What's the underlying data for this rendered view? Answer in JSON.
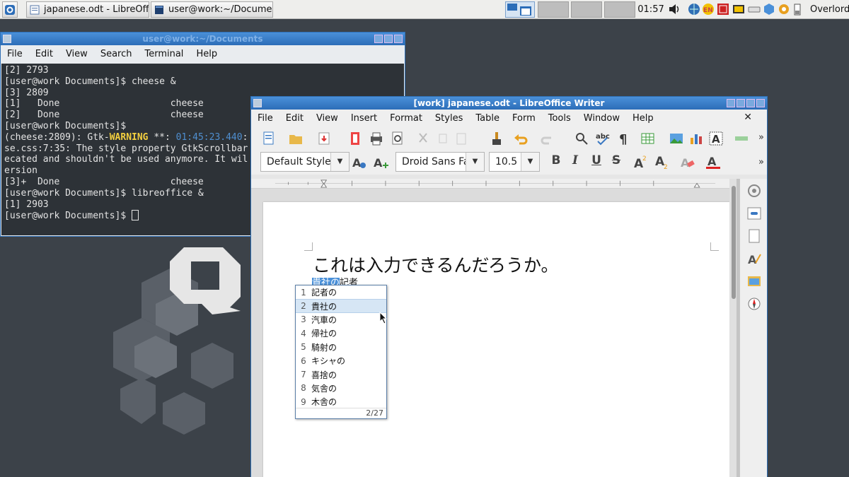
{
  "panel": {
    "tasks": [
      "japanese.odt - LibreOffic...",
      "user@work:~/Documents"
    ],
    "clock": "01:57",
    "user": "Overlord"
  },
  "terminal": {
    "title": "user@work:~/Documents",
    "menu": [
      "File",
      "Edit",
      "View",
      "Search",
      "Terminal",
      "Help"
    ],
    "lines": [
      "[2] 2793",
      "[user@work Documents]$ cheese &",
      "[3] 2809",
      "[1]   Done                    cheese",
      "[2]   Done                    cheese",
      "[user@work Documents]$",
      "se.css:7:35: The style property GtkScrollbar",
      "ecated and shouldn't be used anymore. It wil",
      "ersion",
      "",
      "[3]+  Done                    cheese",
      "[user@work Documents]$ libreoffice &",
      "[1] 2903",
      "[user@work Documents]$ "
    ],
    "warn_prefix": "(cheese:2809): Gtk-",
    "warn_word": "WARNING",
    "warn_mid": " **: ",
    "warn_time": "01:45:23.440",
    "warn_tail": ":"
  },
  "writer": {
    "title": "[work] japanese.odt - LibreOffice Writer",
    "menu": [
      "File",
      "Edit",
      "View",
      "Insert",
      "Format",
      "Styles",
      "Table",
      "Form",
      "Tools",
      "Window",
      "Help"
    ],
    "style": "Default Style",
    "font": "Droid Sans Fa",
    "size": "10.5",
    "line1": "これは入力できるんだろうか。",
    "line2_sel": "貴社の",
    "line2_rest": "記者"
  },
  "ime": {
    "candidates": [
      {
        "n": "1",
        "t": "記者の"
      },
      {
        "n": "2",
        "t": "貴社の"
      },
      {
        "n": "3",
        "t": "汽車の"
      },
      {
        "n": "4",
        "t": "帰社の"
      },
      {
        "n": "5",
        "t": "騎射の"
      },
      {
        "n": "6",
        "t": "キシャの"
      },
      {
        "n": "7",
        "t": "喜捨の"
      },
      {
        "n": "8",
        "t": "気舎の"
      },
      {
        "n": "9",
        "t": "木舎の"
      }
    ],
    "page": "2/27"
  },
  "colors": {
    "accent": "#2c6db8",
    "selection": "#4a90d9",
    "warning": "#f4d03f"
  }
}
